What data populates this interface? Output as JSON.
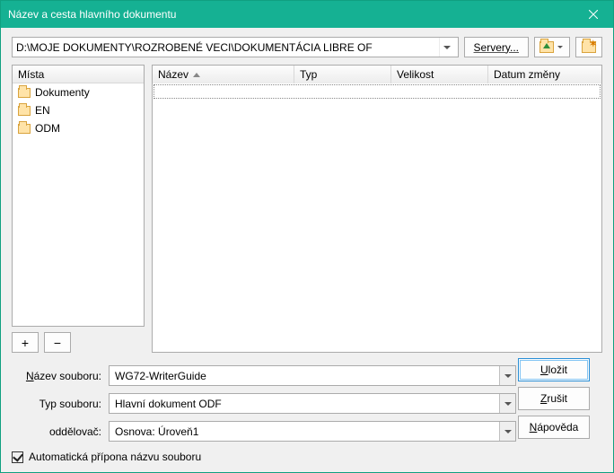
{
  "title": "Název a cesta hlavního dokumentu",
  "path": "D:\\MOJE DOKUMENTY\\ROZROBENÉ VECI\\DOKUMENTÁCIA LIBRE OF",
  "servers_label": "Servery...",
  "places": {
    "header": "Místa",
    "items": [
      "Dokumenty",
      "EN",
      "ODM"
    ]
  },
  "columns": {
    "name": "Název",
    "type": "Typ",
    "size": "Velikost",
    "date": "Datum změny"
  },
  "form": {
    "filename_label": "Název souboru:",
    "filename_value": "WG72-WriterGuide",
    "filetype_label": "Typ souboru:",
    "filetype_value": "Hlavní dokument ODF",
    "separator_label": "oddělovač:",
    "separator_value": "Osnova: Úroveň1"
  },
  "buttons": {
    "save": "Uložit",
    "cancel": "Zrušit",
    "help": "Nápověda",
    "plus": "+",
    "minus": "−"
  },
  "checkbox_label": "Automatická přípona názvu souboru"
}
